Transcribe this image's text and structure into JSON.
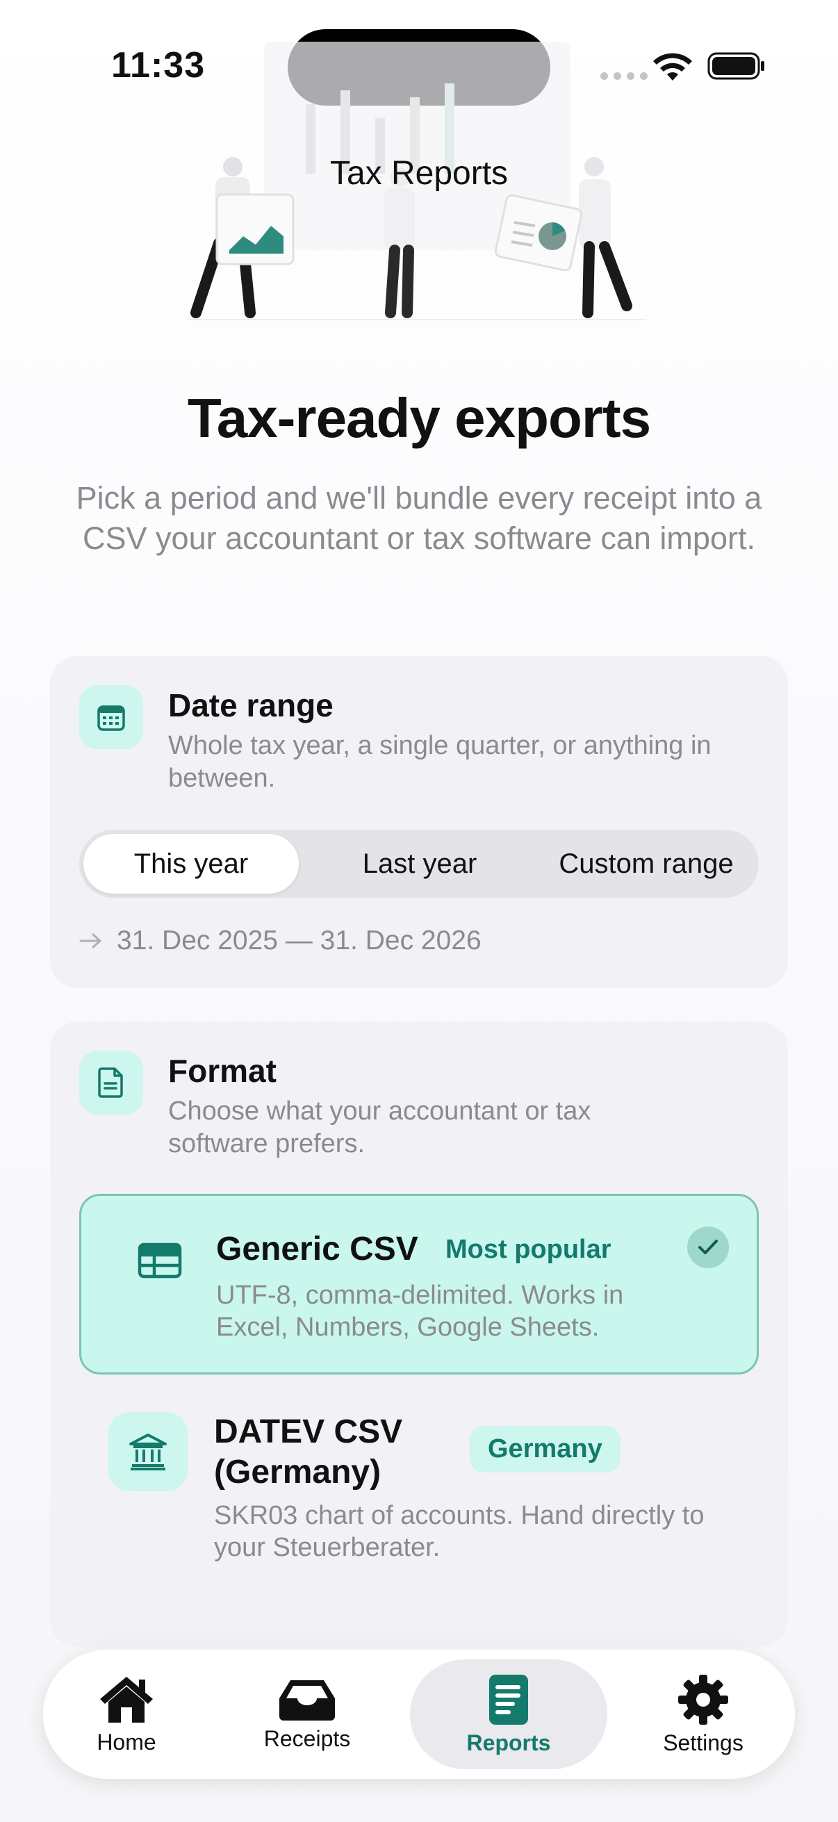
{
  "status_bar": {
    "time": "11:33"
  },
  "nav": {
    "title": "Tax Reports"
  },
  "hero": {
    "title": "Tax-ready exports",
    "subtitle": "Pick a period and we'll bundle every receipt into a CSV your accountant or tax software can import."
  },
  "date_range": {
    "title": "Date range",
    "description": "Whole tax year, a single quarter, or anything in between.",
    "options": [
      "This year",
      "Last year",
      "Custom range"
    ],
    "selected": "This year",
    "range_text": "31. Dec 2025 — 31. Dec 2026"
  },
  "format": {
    "title": "Format",
    "description": "Choose what your accountant or tax software prefers.",
    "options": [
      {
        "title": "Generic CSV",
        "badge": "Most popular",
        "description": "UTF-8, comma-delimited. Works in Excel, Numbers, Google Sheets.",
        "selected": true
      },
      {
        "title": "DATEV CSV (Germany)",
        "title_line1": "DATEV CSV",
        "title_line2": "(Germany)",
        "badge": "Germany",
        "description": "SKR03 chart of accounts. Hand directly to your Steuerberater.",
        "selected": false
      }
    ]
  },
  "tabbar": {
    "tabs": [
      {
        "label": "Home",
        "icon": "house-icon"
      },
      {
        "label": "Receipts",
        "icon": "tray-icon"
      },
      {
        "label": "Reports",
        "icon": "document-text-icon"
      },
      {
        "label": "Settings",
        "icon": "gear-icon"
      }
    ],
    "active": "Reports"
  },
  "colors": {
    "accent": "#137a6c",
    "accent_light": "#cdf6ee",
    "card_bg": "#f2f1f6",
    "secondary_text": "#8a8a8f"
  }
}
